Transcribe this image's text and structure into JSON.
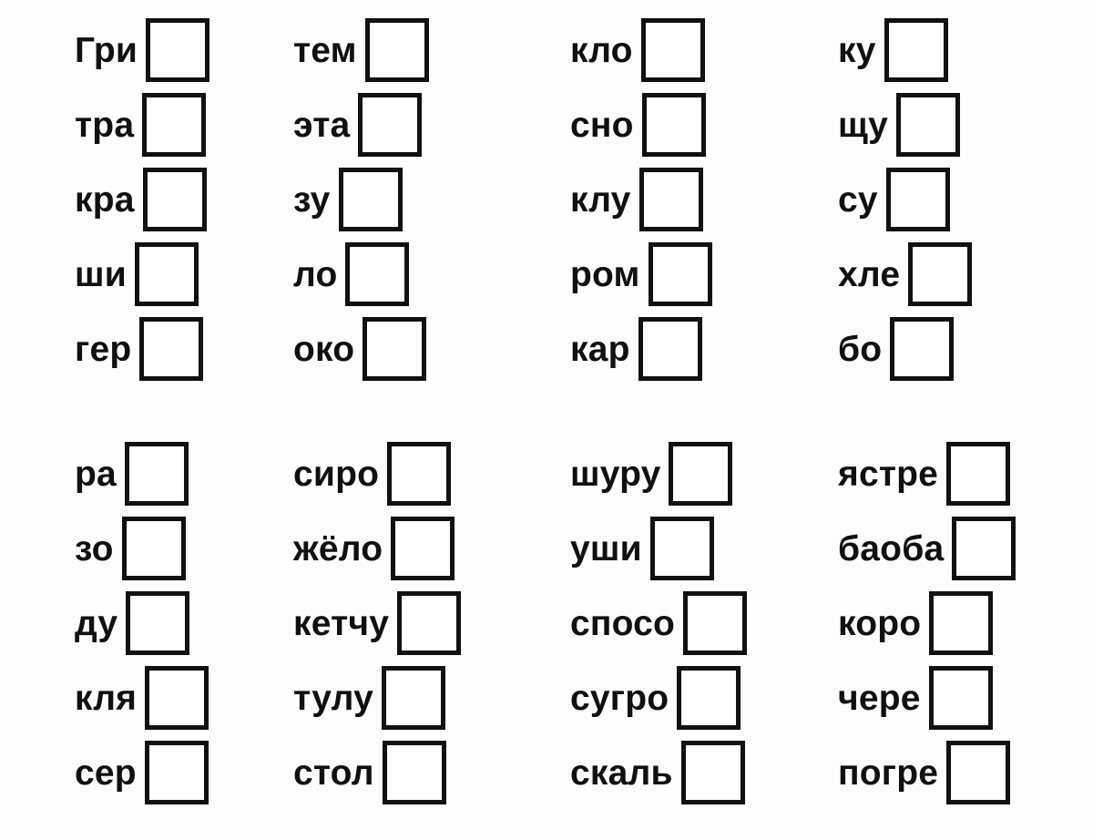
{
  "worksheet": {
    "background_color": "#fdfdfd",
    "ink_color": "#111111",
    "box_label": "",
    "blocks": [
      {
        "name": "top-block",
        "columns": [
          {
            "name": "column-1",
            "items": [
              {
                "syllable": "Гри"
              },
              {
                "syllable": "тра"
              },
              {
                "syllable": "кра"
              },
              {
                "syllable": "ши"
              },
              {
                "syllable": "гер"
              }
            ]
          },
          {
            "name": "column-2",
            "items": [
              {
                "syllable": "тем"
              },
              {
                "syllable": "эта"
              },
              {
                "syllable": "зу"
              },
              {
                "syllable": "ло"
              },
              {
                "syllable": "око"
              }
            ]
          },
          {
            "name": "column-3",
            "items": [
              {
                "syllable": "кло"
              },
              {
                "syllable": "сно"
              },
              {
                "syllable": "клу"
              },
              {
                "syllable": "ром"
              },
              {
                "syllable": "кар"
              }
            ]
          },
          {
            "name": "column-4",
            "items": [
              {
                "syllable": "ку"
              },
              {
                "syllable": "щу"
              },
              {
                "syllable": "су"
              },
              {
                "syllable": "хле"
              },
              {
                "syllable": "бо"
              }
            ]
          }
        ]
      },
      {
        "name": "bottom-block",
        "columns": [
          {
            "name": "column-1",
            "items": [
              {
                "syllable": "ра"
              },
              {
                "syllable": "зо"
              },
              {
                "syllable": "ду"
              },
              {
                "syllable": "кля"
              },
              {
                "syllable": "сер"
              }
            ]
          },
          {
            "name": "column-2",
            "items": [
              {
                "syllable": "сиро"
              },
              {
                "syllable": "жёло"
              },
              {
                "syllable": "кетчу"
              },
              {
                "syllable": "тулу"
              },
              {
                "syllable": "стол"
              }
            ]
          },
          {
            "name": "column-3",
            "items": [
              {
                "syllable": "шуру"
              },
              {
                "syllable": "уши"
              },
              {
                "syllable": "спосо"
              },
              {
                "syllable": "сугро"
              },
              {
                "syllable": "скаль"
              }
            ]
          },
          {
            "name": "column-4",
            "items": [
              {
                "syllable": "ястре"
              },
              {
                "syllable": "баоба"
              },
              {
                "syllable": "коро"
              },
              {
                "syllable": "чере"
              },
              {
                "syllable": "погре"
              }
            ]
          }
        ]
      }
    ]
  }
}
